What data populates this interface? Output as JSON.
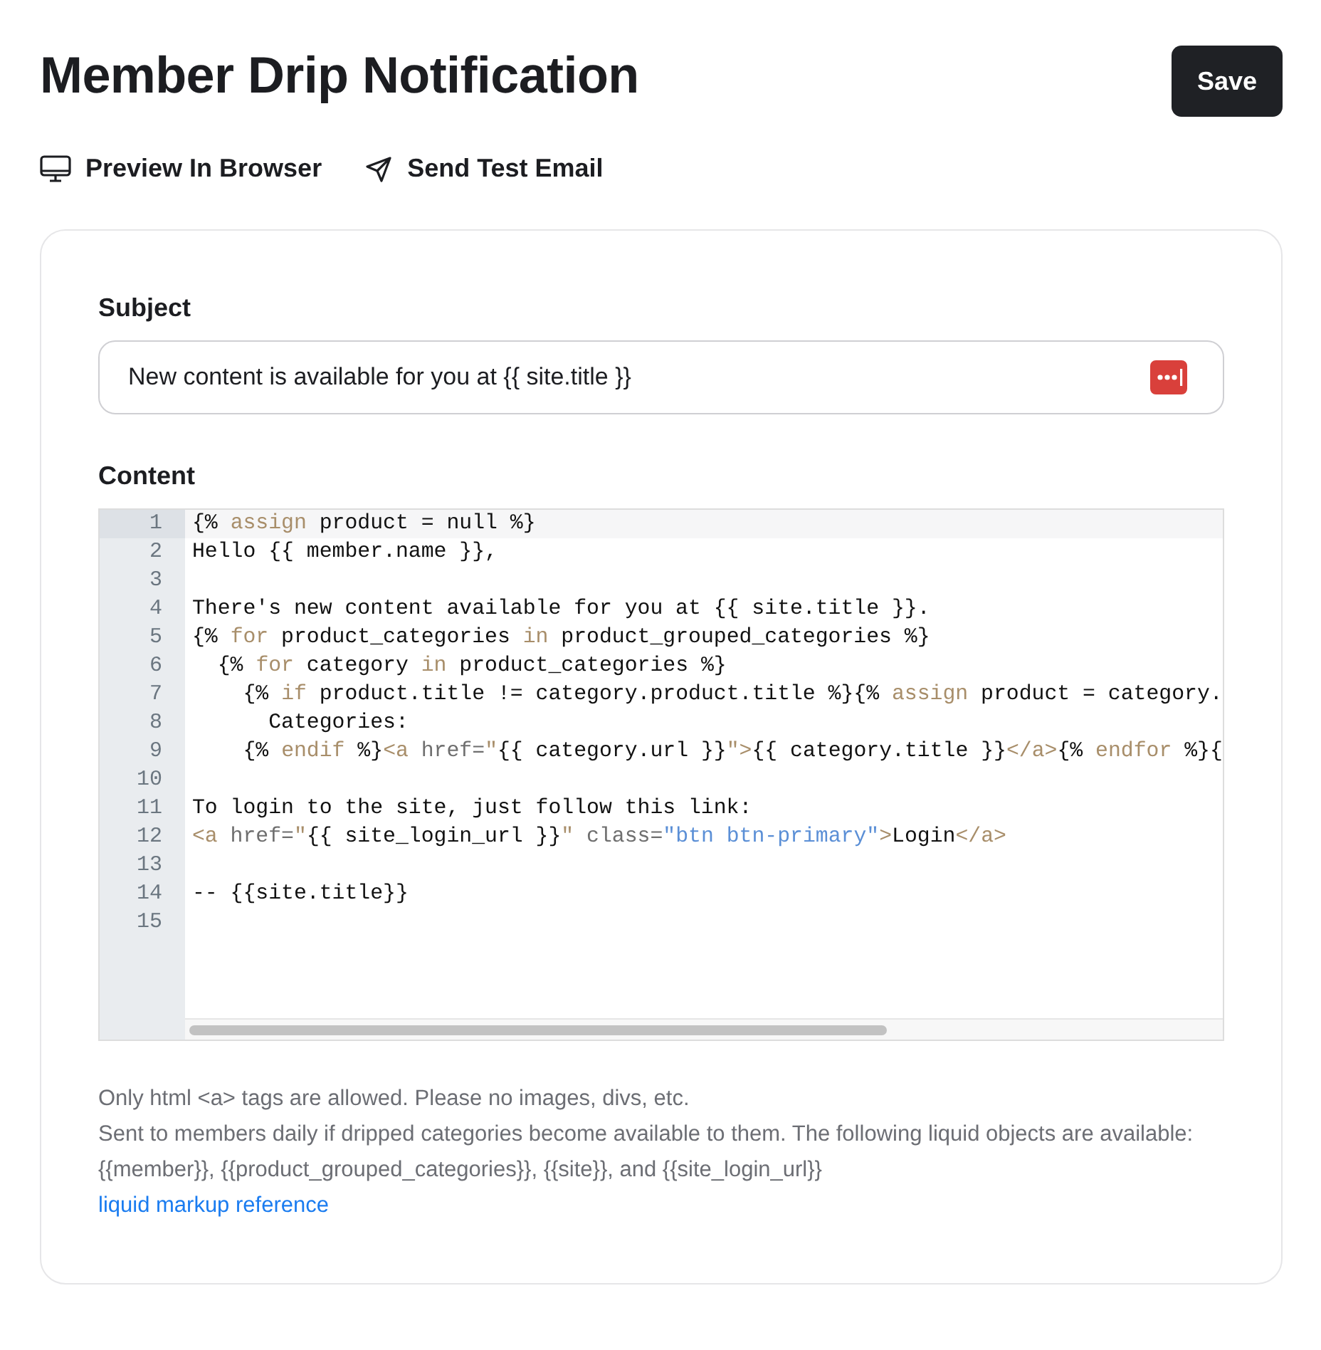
{
  "title": "Member Drip Notification",
  "save_button": "Save",
  "actions": [
    {
      "kind": "preview",
      "label": "Preview In Browser"
    },
    {
      "kind": "send",
      "label": "Send Test Email"
    }
  ],
  "subject": {
    "label": "Subject",
    "value": "New content is available for you at {{ site.title }}"
  },
  "content": {
    "label": "Content",
    "lines": [
      {
        "number": "1",
        "selected": true,
        "tokens": [
          {
            "kind": "plain",
            "text": "{% "
          },
          {
            "kind": "keyword",
            "text": "assign"
          },
          {
            "kind": "plain",
            "text": " product = null %}"
          }
        ]
      },
      {
        "number": "2",
        "tokens": [
          {
            "kind": "plain",
            "text": "Hello {{ member.name }},"
          }
        ]
      },
      {
        "number": "3"
      },
      {
        "number": "4",
        "tokens": [
          {
            "kind": "plain",
            "text": "There's new content available for you at {{ site.title }}."
          }
        ]
      },
      {
        "number": "5",
        "tokens": [
          {
            "kind": "plain",
            "text": "{% "
          },
          {
            "kind": "keyword",
            "text": "for"
          },
          {
            "kind": "plain",
            "text": " product_categories "
          },
          {
            "kind": "keyword",
            "text": "in"
          },
          {
            "kind": "plain",
            "text": " product_grouped_categories %}"
          }
        ]
      },
      {
        "number": "6",
        "tokens": [
          {
            "kind": "plain",
            "text": "  {% "
          },
          {
            "kind": "keyword",
            "text": "for"
          },
          {
            "kind": "plain",
            "text": " category "
          },
          {
            "kind": "keyword",
            "text": "in"
          },
          {
            "kind": "plain",
            "text": " product_categories %}"
          }
        ]
      },
      {
        "number": "7",
        "tokens": [
          {
            "kind": "plain",
            "text": "    {% "
          },
          {
            "kind": "keyword",
            "text": "if"
          },
          {
            "kind": "plain",
            "text": " product.title != category.product.title %}{% "
          },
          {
            "kind": "keyword",
            "text": "assign"
          },
          {
            "kind": "plain",
            "text": " product = category."
          }
        ]
      },
      {
        "number": "8",
        "tokens": [
          {
            "kind": "plain",
            "text": "      Categories:"
          }
        ]
      },
      {
        "number": "9",
        "tokens": [
          {
            "kind": "plain",
            "text": "    {% "
          },
          {
            "kind": "keyword",
            "text": "endif"
          },
          {
            "kind": "plain",
            "text": " %}"
          },
          {
            "kind": "keyword",
            "text": "<a"
          },
          {
            "kind": "attr",
            "text": " href="
          },
          {
            "kind": "keyword",
            "text": "\""
          },
          {
            "kind": "plain",
            "text": "{{ category.url }}"
          },
          {
            "kind": "keyword",
            "text": "\">"
          },
          {
            "kind": "plain",
            "text": "{{ category.title }}"
          },
          {
            "kind": "keyword",
            "text": "</a>"
          },
          {
            "kind": "plain",
            "text": "{% "
          },
          {
            "kind": "keyword",
            "text": "endfor"
          },
          {
            "kind": "plain",
            "text": " %}{"
          }
        ]
      },
      {
        "number": "10"
      },
      {
        "number": "11",
        "tokens": [
          {
            "kind": "plain",
            "text": "To login to the site, just follow this link:"
          }
        ]
      },
      {
        "number": "12",
        "tokens": [
          {
            "kind": "keyword",
            "text": "<a"
          },
          {
            "kind": "attr",
            "text": " href="
          },
          {
            "kind": "keyword",
            "text": "\""
          },
          {
            "kind": "plain",
            "text": "{{ site_login_url }}"
          },
          {
            "kind": "keyword",
            "text": "\""
          },
          {
            "kind": "attr",
            "text": " class="
          },
          {
            "kind": "string",
            "text": "\"btn btn-primary\""
          },
          {
            "kind": "keyword",
            "text": ">"
          },
          {
            "kind": "plain",
            "text": "Login"
          },
          {
            "kind": "keyword",
            "text": "</a>"
          }
        ]
      },
      {
        "number": "13"
      },
      {
        "number": "14",
        "tokens": [
          {
            "kind": "plain",
            "text": "-- {{site.title}}"
          }
        ]
      },
      {
        "number": "15"
      }
    ]
  },
  "help": [
    "Only html <a> tags are allowed. Please no images, divs, etc.",
    "Sent to members daily if dripped categories become available to them. The following liquid objects are available: {{member}}, {{product_grouped_categories}}, {{site}}, and {{site_login_url}}"
  ],
  "reference_link": "liquid markup reference"
}
